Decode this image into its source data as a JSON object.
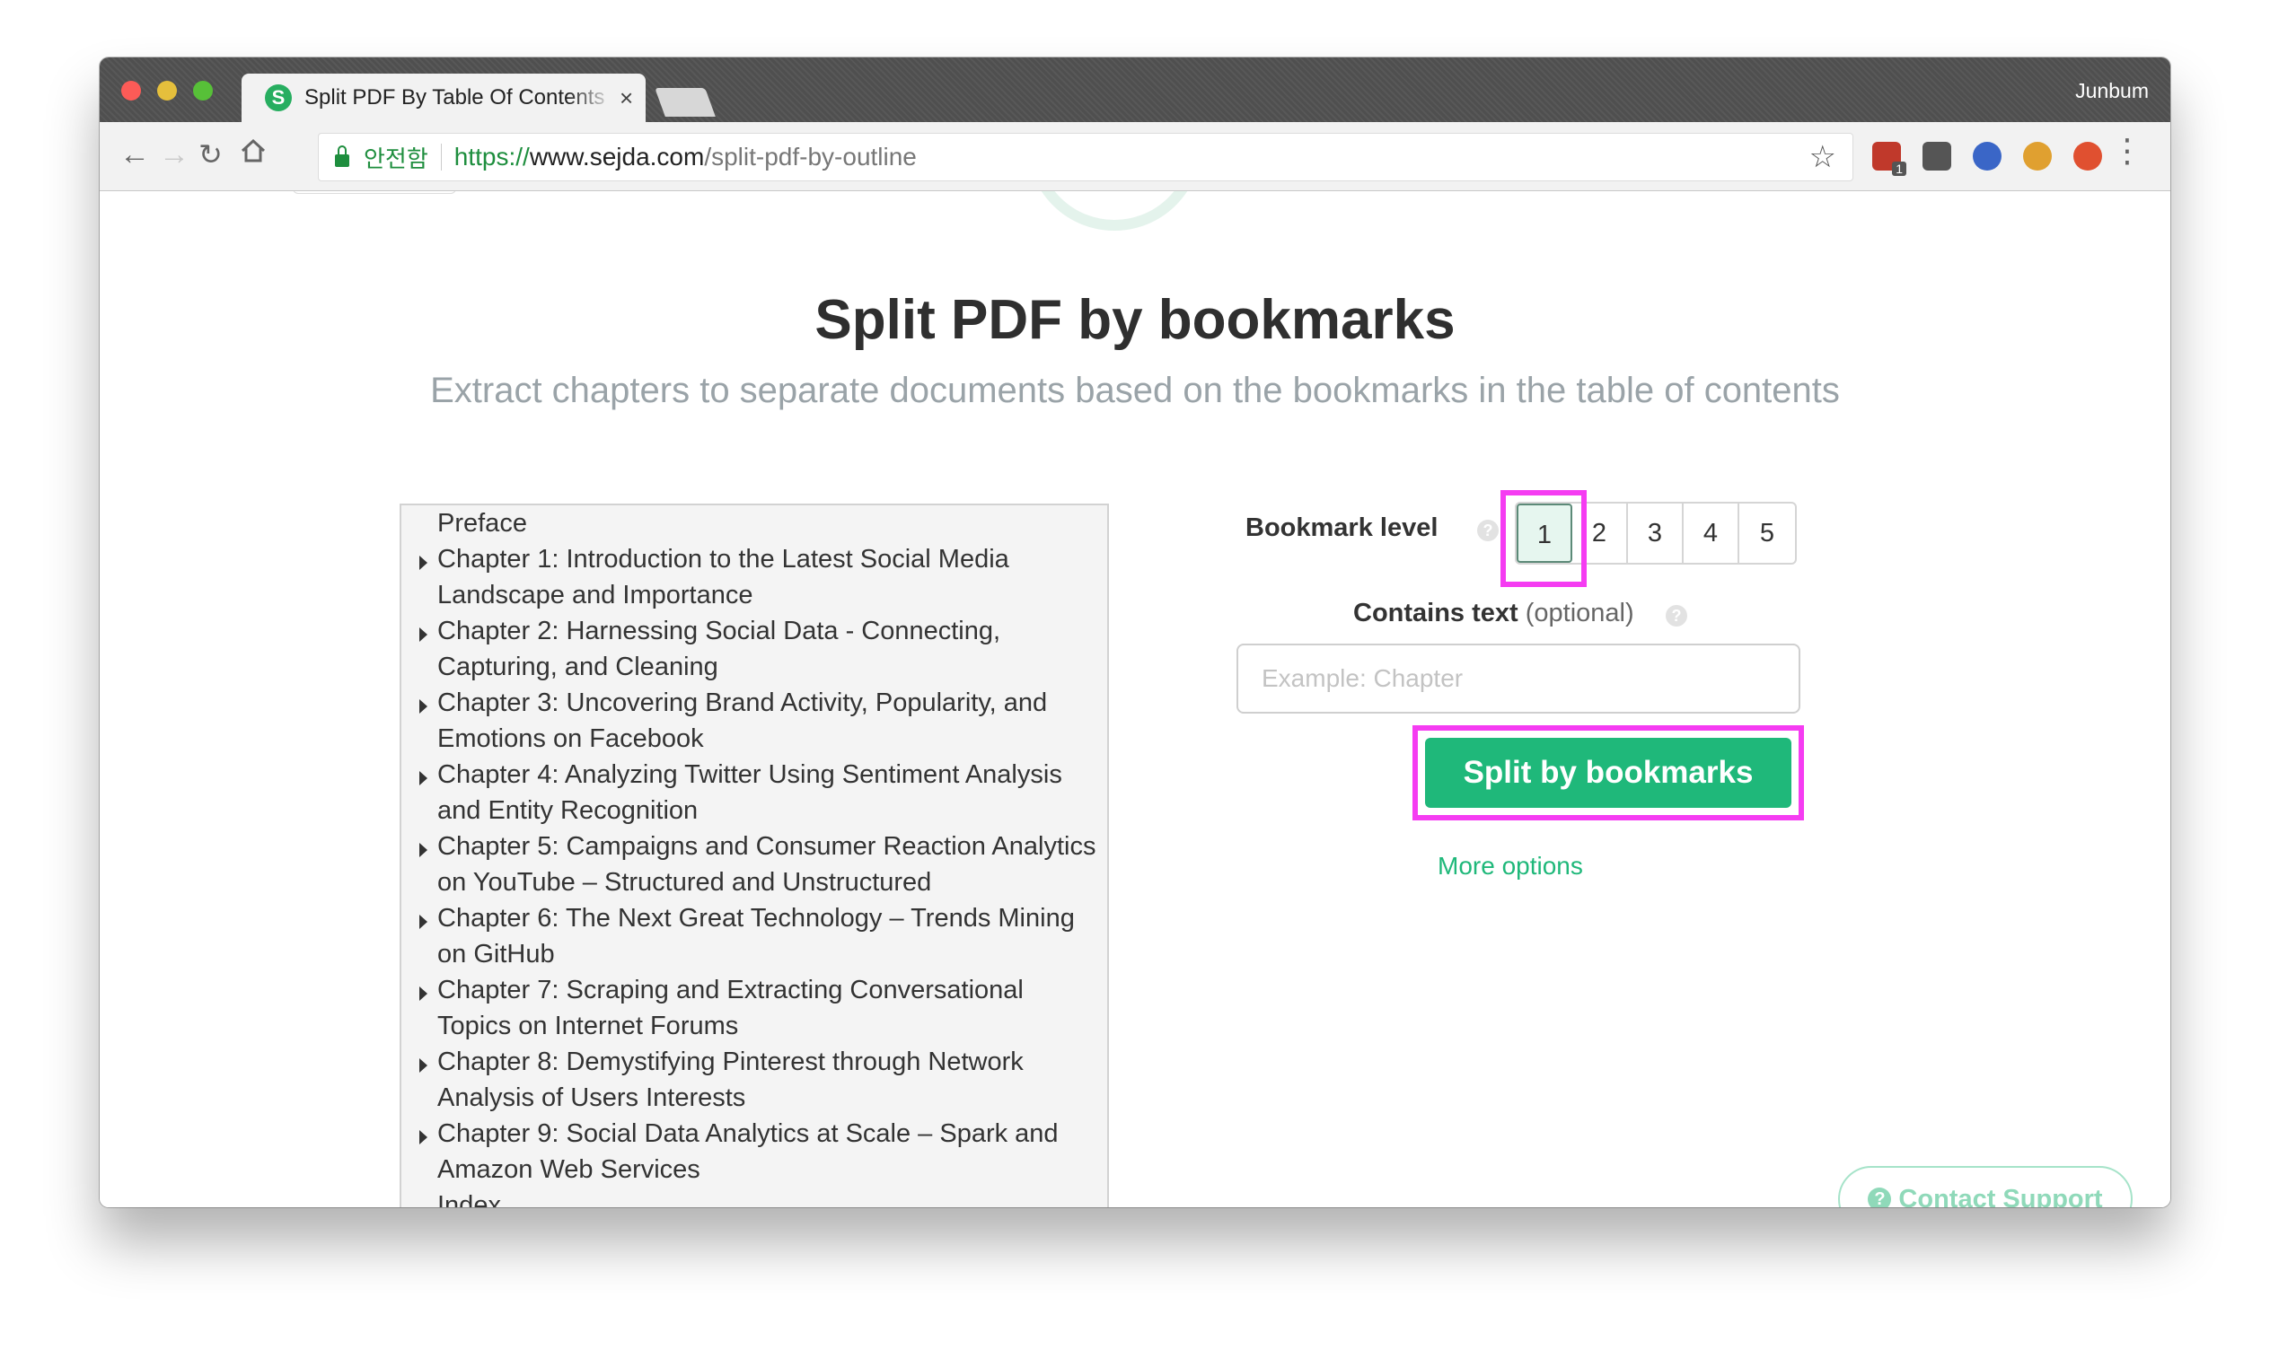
{
  "browser": {
    "tab_title": "Split PDF By Table Of Contents",
    "tab_favicon_letter": "S",
    "tab_close": "×",
    "profile_name": "Junbum",
    "secure_label": "안전함",
    "url_scheme": "https://",
    "url_host": "www.sejda.com",
    "url_path": "/split-pdf-by-outline",
    "icons": {
      "back": "back-arrow-icon",
      "forward": "forward-arrow-icon",
      "reload": "reload-icon",
      "home": "home-icon",
      "bookmark_star": "star-icon",
      "menu": "more-vert-icon"
    },
    "extension_badge": "1",
    "extension_colors": [
      "#c0392b",
      "#555555",
      "#3a66c7",
      "#e0a030",
      "#e05030"
    ]
  },
  "page": {
    "title": "Split PDF by bookmarks",
    "subtitle": "Extract chapters to separate documents based on the bookmarks in the table of contents",
    "outline_items": [
      {
        "label": "Preface",
        "expandable": false
      },
      {
        "label": "Chapter 1: Introduction to the Latest Social Media Landscape and Importance",
        "expandable": true
      },
      {
        "label": "Chapter 2: Harnessing Social Data - Connecting, Capturing, and Cleaning",
        "expandable": true
      },
      {
        "label": "Chapter 3: Uncovering Brand Activity, Popularity, and Emotions on Facebook",
        "expandable": true
      },
      {
        "label": "Chapter 4: Analyzing Twitter Using Sentiment Analysis and Entity Recognition",
        "expandable": true
      },
      {
        "label": "Chapter 5: Campaigns and Consumer Reaction Analytics on YouTube – Structured and Unstructured",
        "expandable": true
      },
      {
        "label": "Chapter 6: The Next Great Technology – Trends Mining on GitHub",
        "expandable": true
      },
      {
        "label": "Chapter 7: Scraping and Extracting Conversational Topics on Internet Forums",
        "expandable": true
      },
      {
        "label": "Chapter 8: Demystifying Pinterest through Network Analysis of Users Interests",
        "expandable": true
      },
      {
        "label": "Chapter 9: Social Data Analytics at Scale – Spark and Amazon Web Services",
        "expandable": true
      },
      {
        "label": "Index",
        "expandable": false
      }
    ],
    "bookmark_level_label": "Bookmark level",
    "bookmark_levels": [
      "1",
      "2",
      "3",
      "4",
      "5"
    ],
    "selected_level": "1",
    "help_glyph": "?",
    "contains_text_label": "Contains text",
    "contains_text_optional": "(optional)",
    "contains_text_placeholder": "Example: Chapter",
    "contains_text_value": "",
    "split_button": "Split by bookmarks",
    "more_options": "More options",
    "contact_support": "Contact Support",
    "colors": {
      "accent": "#1fb87a",
      "highlight": "#f53cf2",
      "subtitle": "#9aa3a8"
    }
  }
}
